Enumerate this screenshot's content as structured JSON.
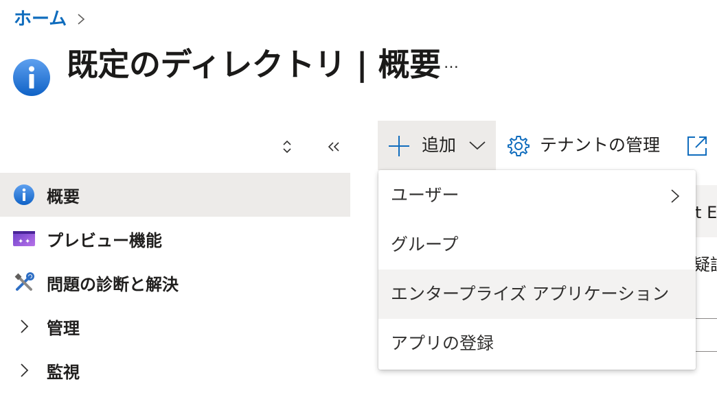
{
  "breadcrumb": {
    "home": "ホーム"
  },
  "page": {
    "title": "既定のディレクトリ | 概要",
    "more": "…"
  },
  "sidebar": {
    "items": [
      {
        "label": "概要",
        "icon": "info-icon",
        "selected": true
      },
      {
        "label": "プレビュー機能",
        "icon": "preview-icon",
        "selected": false
      },
      {
        "label": "問題の診断と解決",
        "icon": "wrench-icon",
        "selected": false
      },
      {
        "label": "管理",
        "icon": "chevron-right-icon",
        "selected": false
      },
      {
        "label": "監視",
        "icon": "chevron-right-icon",
        "selected": false
      }
    ]
  },
  "toolbar": {
    "add_label": "追加",
    "tenant_label": "テナントの管理"
  },
  "dropdown": {
    "items": [
      {
        "label": "ユーザー",
        "has_submenu": true
      },
      {
        "label": "グループ",
        "has_submenu": false
      },
      {
        "label": "エンタープライズ アプリケーション",
        "has_submenu": false,
        "hovered": true
      },
      {
        "label": "アプリの登録",
        "has_submenu": false
      }
    ]
  },
  "background": {
    "partial_text_1": "ft E",
    "partial_text_2": "疑証"
  },
  "colors": {
    "accent": "#0f6cbd",
    "selected_bg": "#edebe9",
    "hover_bg": "#f3f2f1"
  }
}
